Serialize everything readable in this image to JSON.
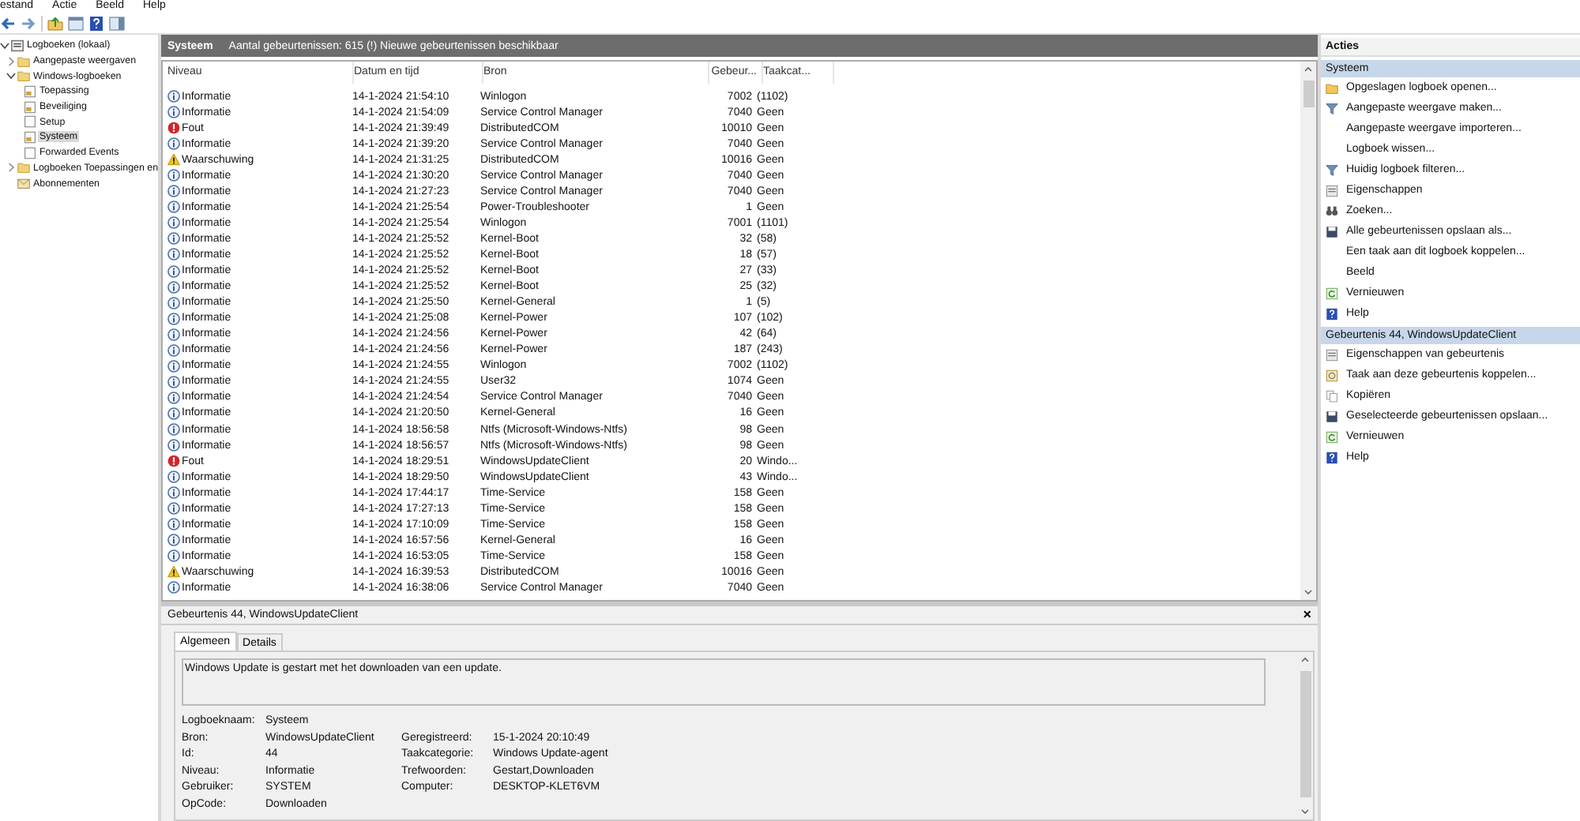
{
  "menu": [
    "estand",
    "Actie",
    "Beeld",
    "Help"
  ],
  "tree": [
    {
      "label": "Logboeken (lokaal)",
      "kind": "computer",
      "expanded": true,
      "selected": false,
      "children": [
        {
          "label": "Aangepaste weergaven",
          "kind": "folder",
          "expanded": false,
          "selected": false
        },
        {
          "label": "Windows-logboeken",
          "kind": "folder",
          "expanded": true,
          "selected": false,
          "children": [
            {
              "label": "Toepassing",
              "kind": "log",
              "selected": false
            },
            {
              "label": "Beveiliging",
              "kind": "log",
              "selected": false
            },
            {
              "label": "Setup",
              "kind": "log-plain",
              "selected": false
            },
            {
              "label": "Systeem",
              "kind": "log",
              "selected": true
            },
            {
              "label": "Forwarded Events",
              "kind": "log-plain",
              "selected": false
            }
          ]
        },
        {
          "label": "Logboeken Toepassingen en",
          "kind": "folder",
          "expanded": false,
          "selected": false
        },
        {
          "label": "Abonnementen",
          "kind": "subscription",
          "selected": false
        }
      ]
    }
  ],
  "log_header": {
    "title": "Systeem",
    "summary": "Aantal gebeurtenissen: 615 (!) Nieuwe gebeurtenissen beschikbaar"
  },
  "table": {
    "columns": [
      "Niveau",
      "Datum en tijd",
      "Bron",
      "Gebeur...",
      "Taakcat..."
    ],
    "rows": [
      {
        "kind": "info",
        "niveau": "Informatie",
        "datetime": "14-1-2024 21:54:10",
        "source": "Winlogon",
        "event_id": "7002",
        "task": "(1102)"
      },
      {
        "kind": "info",
        "niveau": "Informatie",
        "datetime": "14-1-2024 21:54:09",
        "source": "Service Control Manager",
        "event_id": "7040",
        "task": "Geen"
      },
      {
        "kind": "error",
        "niveau": "Fout",
        "datetime": "14-1-2024 21:39:49",
        "source": "DistributedCOM",
        "event_id": "10010",
        "task": "Geen"
      },
      {
        "kind": "info",
        "niveau": "Informatie",
        "datetime": "14-1-2024 21:39:20",
        "source": "Service Control Manager",
        "event_id": "7040",
        "task": "Geen"
      },
      {
        "kind": "warning",
        "niveau": "Waarschuwing",
        "datetime": "14-1-2024 21:31:25",
        "source": "DistributedCOM",
        "event_id": "10016",
        "task": "Geen"
      },
      {
        "kind": "info",
        "niveau": "Informatie",
        "datetime": "14-1-2024 21:30:20",
        "source": "Service Control Manager",
        "event_id": "7040",
        "task": "Geen"
      },
      {
        "kind": "info",
        "niveau": "Informatie",
        "datetime": "14-1-2024 21:27:23",
        "source": "Service Control Manager",
        "event_id": "7040",
        "task": "Geen"
      },
      {
        "kind": "info",
        "niveau": "Informatie",
        "datetime": "14-1-2024 21:25:54",
        "source": "Power-Troubleshooter",
        "event_id": "1",
        "task": "Geen"
      },
      {
        "kind": "info",
        "niveau": "Informatie",
        "datetime": "14-1-2024 21:25:54",
        "source": "Winlogon",
        "event_id": "7001",
        "task": "(1101)"
      },
      {
        "kind": "info",
        "niveau": "Informatie",
        "datetime": "14-1-2024 21:25:52",
        "source": "Kernel-Boot",
        "event_id": "32",
        "task": "(58)"
      },
      {
        "kind": "info",
        "niveau": "Informatie",
        "datetime": "14-1-2024 21:25:52",
        "source": "Kernel-Boot",
        "event_id": "18",
        "task": "(57)"
      },
      {
        "kind": "info",
        "niveau": "Informatie",
        "datetime": "14-1-2024 21:25:52",
        "source": "Kernel-Boot",
        "event_id": "27",
        "task": "(33)"
      },
      {
        "kind": "info",
        "niveau": "Informatie",
        "datetime": "14-1-2024 21:25:52",
        "source": "Kernel-Boot",
        "event_id": "25",
        "task": "(32)"
      },
      {
        "kind": "info",
        "niveau": "Informatie",
        "datetime": "14-1-2024 21:25:50",
        "source": "Kernel-General",
        "event_id": "1",
        "task": "(5)"
      },
      {
        "kind": "info",
        "niveau": "Informatie",
        "datetime": "14-1-2024 21:25:08",
        "source": "Kernel-Power",
        "event_id": "107",
        "task": "(102)"
      },
      {
        "kind": "info",
        "niveau": "Informatie",
        "datetime": "14-1-2024 21:24:56",
        "source": "Kernel-Power",
        "event_id": "42",
        "task": "(64)"
      },
      {
        "kind": "info",
        "niveau": "Informatie",
        "datetime": "14-1-2024 21:24:56",
        "source": "Kernel-Power",
        "event_id": "187",
        "task": "(243)"
      },
      {
        "kind": "info",
        "niveau": "Informatie",
        "datetime": "14-1-2024 21:24:55",
        "source": "Winlogon",
        "event_id": "7002",
        "task": "(1102)"
      },
      {
        "kind": "info",
        "niveau": "Informatie",
        "datetime": "14-1-2024 21:24:55",
        "source": "User32",
        "event_id": "1074",
        "task": "Geen"
      },
      {
        "kind": "info",
        "niveau": "Informatie",
        "datetime": "14-1-2024 21:24:54",
        "source": "Service Control Manager",
        "event_id": "7040",
        "task": "Geen"
      },
      {
        "kind": "info",
        "niveau": "Informatie",
        "datetime": "14-1-2024 21:20:50",
        "source": "Kernel-General",
        "event_id": "16",
        "task": "Geen"
      },
      {
        "kind": "info",
        "niveau": "Informatie",
        "datetime": "14-1-2024 18:56:58",
        "source": "Ntfs (Microsoft-Windows-Ntfs)",
        "event_id": "98",
        "task": "Geen"
      },
      {
        "kind": "info",
        "niveau": "Informatie",
        "datetime": "14-1-2024 18:56:57",
        "source": "Ntfs (Microsoft-Windows-Ntfs)",
        "event_id": "98",
        "task": "Geen"
      },
      {
        "kind": "error",
        "niveau": "Fout",
        "datetime": "14-1-2024 18:29:51",
        "source": "WindowsUpdateClient",
        "event_id": "20",
        "task": "Windo..."
      },
      {
        "kind": "info",
        "niveau": "Informatie",
        "datetime": "14-1-2024 18:29:50",
        "source": "WindowsUpdateClient",
        "event_id": "43",
        "task": "Windo..."
      },
      {
        "kind": "info",
        "niveau": "Informatie",
        "datetime": "14-1-2024 17:44:17",
        "source": "Time-Service",
        "event_id": "158",
        "task": "Geen"
      },
      {
        "kind": "info",
        "niveau": "Informatie",
        "datetime": "14-1-2024 17:27:13",
        "source": "Time-Service",
        "event_id": "158",
        "task": "Geen"
      },
      {
        "kind": "info",
        "niveau": "Informatie",
        "datetime": "14-1-2024 17:10:09",
        "source": "Time-Service",
        "event_id": "158",
        "task": "Geen"
      },
      {
        "kind": "info",
        "niveau": "Informatie",
        "datetime": "14-1-2024 16:57:56",
        "source": "Kernel-General",
        "event_id": "16",
        "task": "Geen"
      },
      {
        "kind": "info",
        "niveau": "Informatie",
        "datetime": "14-1-2024 16:53:05",
        "source": "Time-Service",
        "event_id": "158",
        "task": "Geen"
      },
      {
        "kind": "warning",
        "niveau": "Waarschuwing",
        "datetime": "14-1-2024 16:39:53",
        "source": "DistributedCOM",
        "event_id": "10016",
        "task": "Geen"
      },
      {
        "kind": "info",
        "niveau": "Informatie",
        "datetime": "14-1-2024 16:38:06",
        "source": "Service Control Manager",
        "event_id": "7040",
        "task": "Geen"
      }
    ]
  },
  "detail": {
    "title": "Gebeurtenis 44, WindowsUpdateClient",
    "close": "×",
    "tabs": [
      {
        "label": "Algemeen",
        "selected": true
      },
      {
        "label": "Details",
        "selected": false
      }
    ],
    "message": "Windows Update is gestart met het downloaden van een update.",
    "fields": [
      {
        "label": "Logboeknaam:",
        "value": "Systeem"
      },
      {
        "label": "Bron:",
        "value": "WindowsUpdateClient",
        "label_2": "Geregistreerd:",
        "value_2": "15-1-2024 20:10:49"
      },
      {
        "label": "Id:",
        "value": "44",
        "label_2": "Taakcategorie:",
        "value_2": "Windows Update-agent"
      },
      {
        "label": "Niveau:",
        "value": "Informatie",
        "label_2": "Trefwoorden:",
        "value_2": "Gestart,Downloaden"
      },
      {
        "label": "Gebruiker:",
        "value": "SYSTEM",
        "label_2": "Computer:",
        "value_2": "DESKTOP-KLET6VM"
      },
      {
        "label": "OpCode:",
        "value": "Downloaden"
      }
    ]
  },
  "actions": {
    "title": "Acties",
    "sections": [
      {
        "title": "Systeem",
        "items": [
          {
            "label": "Opgeslagen logboek openen...",
            "kind": "folder"
          },
          {
            "label": "Aangepaste weergave maken...",
            "kind": "filter"
          },
          {
            "label": "Aangepaste weergave importeren...",
            "kind": "none"
          },
          {
            "label": "Logboek wissen...",
            "kind": "none"
          },
          {
            "label": "Huidig logboek filteren...",
            "kind": "filter"
          },
          {
            "label": "Eigenschappen",
            "kind": "properties"
          },
          {
            "label": "Zoeken...",
            "kind": "find"
          },
          {
            "label": "Alle gebeurtenissen opslaan als...",
            "kind": "save"
          },
          {
            "label": "Een taak aan dit logboek koppelen...",
            "kind": "none"
          },
          {
            "label": "Beeld",
            "kind": "none"
          },
          {
            "label": "Vernieuwen",
            "kind": "refresh"
          },
          {
            "label": "Help",
            "kind": "help"
          }
        ]
      },
      {
        "title": "Gebeurtenis 44, WindowsUpdateClient",
        "items": [
          {
            "label": "Eigenschappen van gebeurtenis",
            "kind": "properties"
          },
          {
            "label": "Taak aan deze gebeurtenis koppelen...",
            "kind": "task"
          },
          {
            "label": "Kopiëren",
            "kind": "copy"
          },
          {
            "label": "Geselecteerde gebeurtenissen opslaan...",
            "kind": "save"
          },
          {
            "label": "Vernieuwen",
            "kind": "refresh"
          },
          {
            "label": "Help",
            "kind": "help"
          }
        ]
      }
    ]
  }
}
